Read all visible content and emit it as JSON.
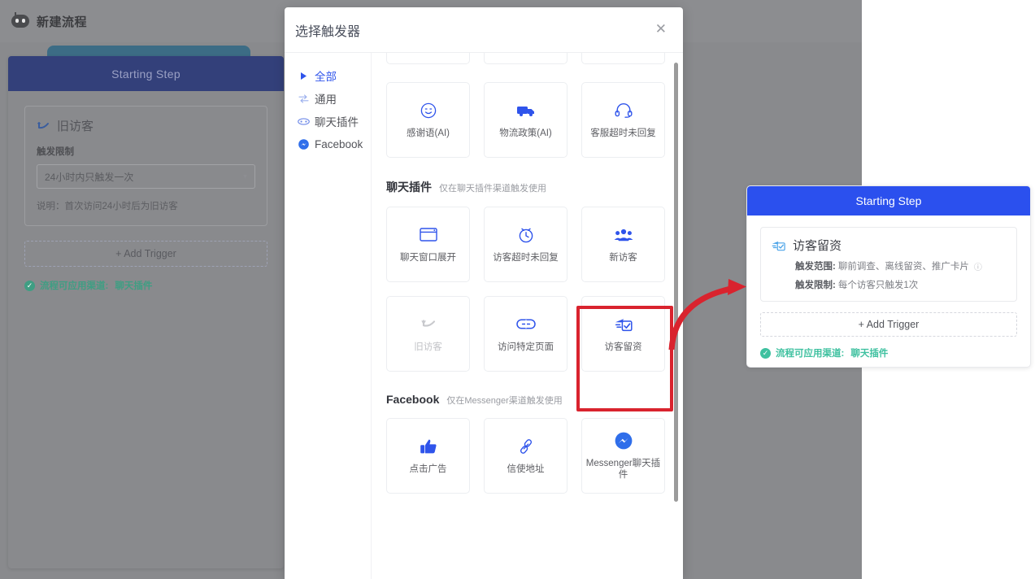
{
  "background_app": {
    "title": "新建流程",
    "robot_icon": "robot-icon",
    "flow_card": {
      "header": "Starting Step",
      "trigger": {
        "icon": "back-arrow-icon",
        "name": "旧访客",
        "limit_label": "触发限制",
        "limit_value": "24小时内只触发一次",
        "dropdown_icon": "chevron-down-icon",
        "description": "说明：首次访问24小时后为旧访客"
      },
      "add_trigger_label": "+ Add Trigger",
      "channel": {
        "check_icon": "check-circle-icon",
        "label": "流程可应用渠道:",
        "value": "聊天插件"
      }
    }
  },
  "modal": {
    "title": "选择触发器",
    "close_icon": "close-icon",
    "nav": [
      {
        "label": "全部",
        "icon": "play-triangle-icon",
        "active": true
      },
      {
        "label": "通用",
        "icon": "exchange-icon",
        "active": false
      },
      {
        "label": "聊天插件",
        "icon": "chat-widget-icon",
        "active": false
      },
      {
        "label": "Facebook",
        "icon": "messenger-icon",
        "active": false
      }
    ],
    "partial_top_row": [
      "",
      "",
      ""
    ],
    "visible_top_cards": [
      {
        "label": "感谢语(AI)",
        "icon": "smiley-icon",
        "disabled": false
      },
      {
        "label": "物流政策(AI)",
        "icon": "truck-icon",
        "disabled": false
      },
      {
        "label": "客服超时未回复",
        "icon": "headset-icon",
        "disabled": false
      }
    ],
    "sections": [
      {
        "title": "聊天插件",
        "subtitle": "仅在聊天插件渠道触发使用",
        "cards": [
          {
            "label": "聊天窗口展开",
            "icon": "window-icon",
            "disabled": false,
            "highlighted": false
          },
          {
            "label": "访客超时未回复",
            "icon": "alarm-clock-icon",
            "disabled": false,
            "highlighted": false
          },
          {
            "label": "新访客",
            "icon": "people-icon",
            "disabled": false,
            "highlighted": false
          },
          {
            "label": "旧访客",
            "icon": "back-arrow-icon",
            "disabled": true,
            "highlighted": false
          },
          {
            "label": "访问特定页面",
            "icon": "link-icon",
            "disabled": false,
            "highlighted": false
          },
          {
            "label": "访客留资",
            "icon": "send-check-icon",
            "disabled": false,
            "highlighted": true
          }
        ]
      },
      {
        "title": "Facebook",
        "subtitle": "仅在Messenger渠道触发使用",
        "cards": [
          {
            "label": "点击广告",
            "icon": "thumbs-up-icon",
            "disabled": false,
            "highlighted": false
          },
          {
            "label": "信使地址",
            "icon": "link-chain-icon",
            "disabled": false,
            "highlighted": false
          },
          {
            "label": "Messenger聊天插件",
            "icon": "messenger-icon",
            "disabled": false,
            "highlighted": false
          }
        ]
      }
    ],
    "scrollbar": "vertical-scrollbar"
  },
  "preview": {
    "header": "Starting Step",
    "trigger": {
      "icon": "send-check-icon",
      "name": "访客留资",
      "scope_key": "触发范围:",
      "scope_value": "聊前调查、离线留资、推广卡片",
      "help_icon": "help-circle-icon",
      "limit_key": "触发限制:",
      "limit_value": "每个访客只触发1次"
    },
    "add_trigger_label": "+ Add Trigger",
    "channel": {
      "check_icon": "check-circle-icon",
      "label": "流程可应用渠道:",
      "value": "聊天插件"
    }
  },
  "annotations": {
    "highlight_color": "#d9232e",
    "highlight_target": "访客留资",
    "arrow": "curved-arrow-right"
  }
}
